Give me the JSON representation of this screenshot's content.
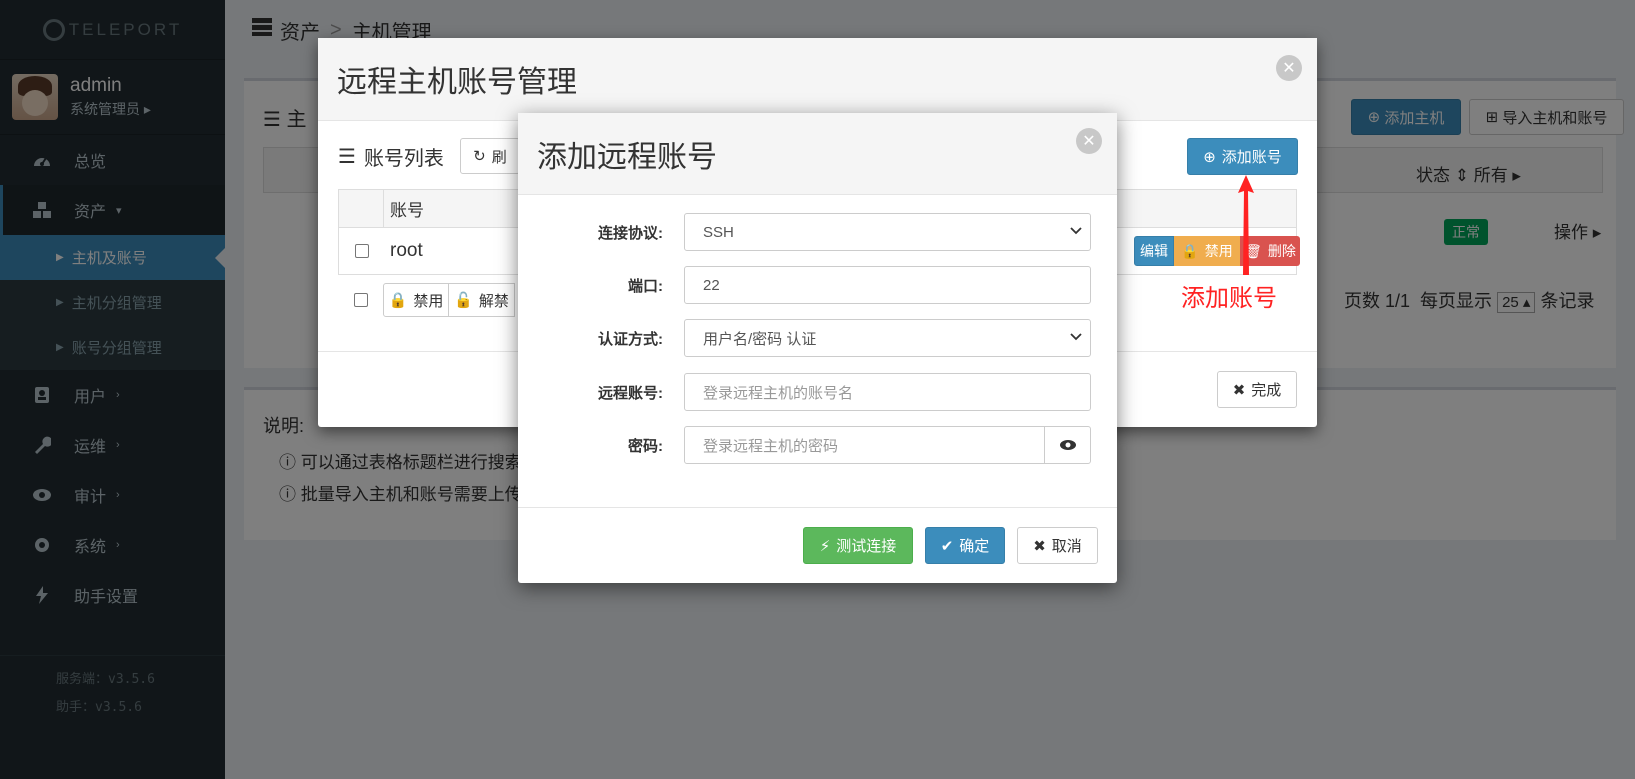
{
  "logo": {
    "text": "TELEPORT"
  },
  "user": {
    "name": "admin",
    "role": "系统管理员"
  },
  "menu": {
    "overview": "总览",
    "assets": "资产",
    "sub_hosts": "主机及账号",
    "sub_host_groups": "主机分组管理",
    "sub_account_groups": "账号分组管理",
    "users": "用户",
    "ops": "运维",
    "audit": "审计",
    "system": "系统",
    "assistant": "助手设置"
  },
  "versions": {
    "server": "服务端：v3.5.6",
    "assistant": "助手：v3.5.6"
  },
  "breadcrumb": {
    "root": "资产",
    "sep": ">",
    "current": "主机管理"
  },
  "background": {
    "section_title_partial": "主",
    "add_host_button": "添加主机",
    "import_button": "导入主机和账号",
    "status_header": "状态",
    "status_filter": "所有",
    "status_badge": "正常",
    "ops_button": "操作",
    "pager_text": "页数 1/1",
    "page_size_label": "每页显示",
    "page_size_value": "25",
    "records_label": "条记录",
    "notes_title": "说明:",
    "note1": "可以通过表格标题栏进行搜索",
    "note2": "批量导入主机和账号需要上传"
  },
  "outer_modal": {
    "title": "远程主机账号管理",
    "list_title": "账号列表",
    "refresh_partial": "刷",
    "add_account_button": "添加账号",
    "column_account": "账号",
    "row_account": "root",
    "edit_button": "编辑",
    "disable_button": "禁用",
    "delete_button": "删除",
    "bulk_disable": "禁用",
    "bulk_unlock": "解禁",
    "done_button": "完成"
  },
  "inner_modal": {
    "title": "添加远程账号",
    "protocol_label": "连接协议:",
    "protocol_value": "SSH",
    "port_label": "端口:",
    "port_value": "22",
    "auth_label": "认证方式:",
    "auth_value": "用户名/密码 认证",
    "account_label": "远程账号:",
    "account_placeholder": "登录远程主机的账号名",
    "password_label": "密码:",
    "password_placeholder": "登录远程主机的密码",
    "test_button": "测试连接",
    "ok_button": "确定",
    "cancel_button": "取消"
  },
  "annotation": {
    "text": "添加账号"
  },
  "colors": {
    "primary": "#3c8dbc",
    "success": "#5cb85c",
    "warning": "#f0ad4e",
    "danger": "#d9534f",
    "sidebar": "#222d32",
    "annotation": "#ff2222"
  }
}
